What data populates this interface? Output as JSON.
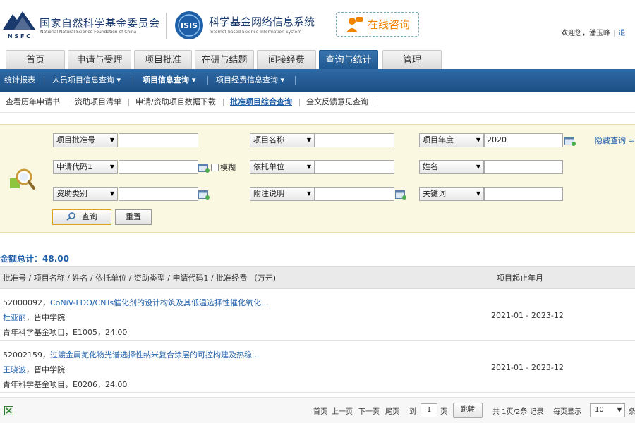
{
  "header": {
    "nsfc_name": "国家自然科学基金委员会",
    "nsfc_en": "National Natural Science Foundation of China",
    "nsfc_abbr": "N S F C",
    "isis_logo_text": "ISIS",
    "system_name": "科学基金网络信息系统",
    "system_en": "Internet-based Science Information System",
    "consult_label": "在线咨询",
    "welcome": "欢迎您，潘玉峰",
    "exit_label": "退"
  },
  "tabs": [
    {
      "label": "首页"
    },
    {
      "label": "申请与受理"
    },
    {
      "label": "项目批准"
    },
    {
      "label": "在研与结题"
    },
    {
      "label": "间接经费"
    },
    {
      "label": "查询与统计",
      "active": true
    },
    {
      "label": "管理"
    }
  ],
  "nav": [
    {
      "label": "统计报表"
    },
    {
      "label": "人员项目信息查询 ▾"
    },
    {
      "label": "项目信息查询 ▾",
      "active": true
    },
    {
      "label": "项目经费信息查询 ▾"
    }
  ],
  "subnav": [
    {
      "label": "查看历年申请书"
    },
    {
      "label": "资助项目清单"
    },
    {
      "label": "申请/资助项目数据下载"
    },
    {
      "label": "批准项目综合查询",
      "active": true
    },
    {
      "label": "全文反馈意见查询"
    }
  ],
  "search": {
    "row1": {
      "f1_label": "项目批准号",
      "f1_value": "",
      "f2_label": "项目名称",
      "f2_value": "",
      "f3_label": "项目年度",
      "f3_value": "2020"
    },
    "row2": {
      "f1_label": "申请代码1",
      "f1_value": "",
      "fuzzy_label": "模糊",
      "f2_label": "依托单位",
      "f2_value": "",
      "f3_label": "姓名",
      "f3_value": ""
    },
    "row3": {
      "f1_label": "资助类别",
      "f1_value": "",
      "f2_label": "附注说明",
      "f2_value": "",
      "f3_label": "关键词",
      "f3_value": ""
    },
    "hide_label": "隐藏查询 ≈",
    "query_button": "查询",
    "reset_button": "重置"
  },
  "summary": {
    "total_label": "金额总计：48.00"
  },
  "table": {
    "header_main": "批准号 / 项目名称 / 姓名 / 依托单位 / 资助类型 / 申请代码1 / 批准经费 （万元)",
    "header_period": "项目起止年月",
    "rows": [
      {
        "id": "52000092，",
        "title": "CoNiV-LDO/CNTs催化剂的设计构筑及其低温选择性催化氧化...",
        "person": "杜亚丽",
        "unit": "，晋中学院",
        "detail": "青年科学基金项目，E1005，24.00",
        "period": "2021-01 - 2023-12"
      },
      {
        "id": "52002159，",
        "title": "过渡金属氮化物光谱选择性纳米复合涂层的可控构建及热稳...",
        "person": "王晓波",
        "unit": "，晋中学院",
        "detail": "青年科学基金项目，E0206，24.00",
        "period": "2021-01 - 2023-12"
      }
    ]
  },
  "pager": {
    "first": "首页",
    "prev": "上一页",
    "next": "下一页",
    "last": "尾页",
    "to": "到",
    "page_value": "1",
    "page_unit": "页",
    "jump": "跳转",
    "info": "共 1页/2条 记录",
    "per_page_label": "每页显示",
    "per_page_value": "10",
    "tail": "条"
  },
  "colors": {
    "brand_blue": "#1f5891",
    "link_blue": "#1f5fa8",
    "search_bg": "#fbf8e1",
    "consult_orange": "#f08300"
  }
}
